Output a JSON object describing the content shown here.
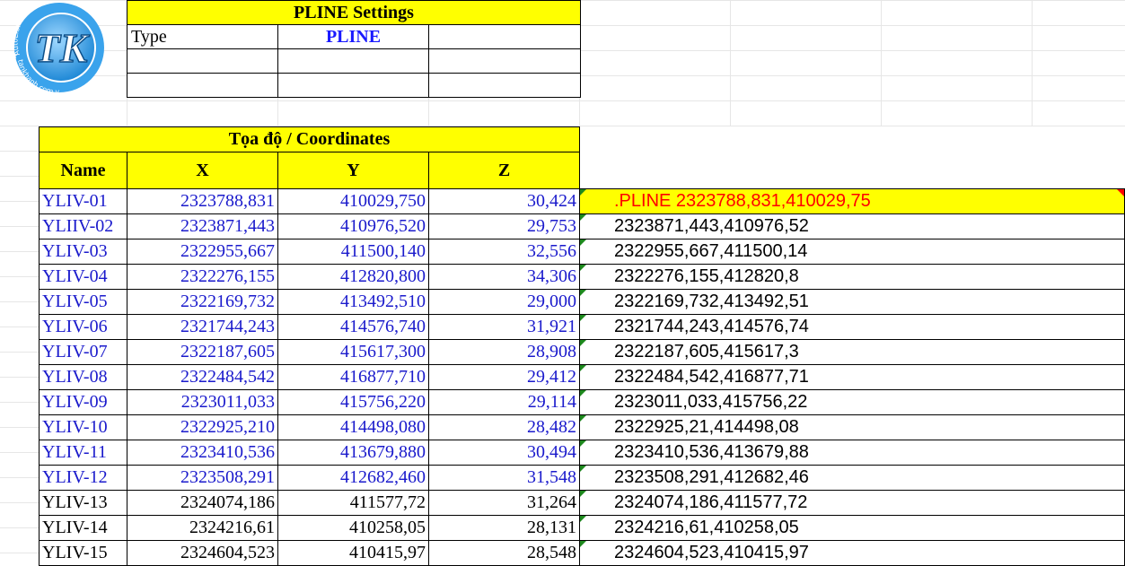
{
  "logo": {
    "initials": "TK",
    "ring_text_top": "AutoLISP Reviewer",
    "ring_text_bottom": "tankhanh.com.vn",
    "star": "★"
  },
  "settings": {
    "title": "PLINE Settings",
    "type_label": "Type",
    "type_value": "PLINE"
  },
  "coords": {
    "title": "Tọa độ / Coordinates",
    "headers": {
      "name": "Name",
      "x": "X",
      "y": "Y",
      "z": "Z"
    },
    "rows": [
      {
        "name": "YLIV-01",
        "x": "2323788,831",
        "y": "410029,750",
        "z": "30,424",
        "result": ".PLINE 2323788,831,410029,75"
      },
      {
        "name": "YLIIV-02",
        "x": "2323871,443",
        "y": "410976,520",
        "z": "29,753",
        "result": "2323871,443,410976,52"
      },
      {
        "name": "YLIV-03",
        "x": "2322955,667",
        "y": "411500,140",
        "z": "32,556",
        "result": "2322955,667,411500,14"
      },
      {
        "name": "YLIV-04",
        "x": "2322276,155",
        "y": "412820,800",
        "z": "34,306",
        "result": "2322276,155,412820,8"
      },
      {
        "name": "YLIV-05",
        "x": "2322169,732",
        "y": "413492,510",
        "z": "29,000",
        "result": "2322169,732,413492,51"
      },
      {
        "name": "YLIV-06",
        "x": "2321744,243",
        "y": "414576,740",
        "z": "31,921",
        "result": "2321744,243,414576,74"
      },
      {
        "name": "YLIV-07",
        "x": "2322187,605",
        "y": "415617,300",
        "z": "28,908",
        "result": "2322187,605,415617,3"
      },
      {
        "name": "YLIV-08",
        "x": "2322484,542",
        "y": "416877,710",
        "z": "29,412",
        "result": "2322484,542,416877,71"
      },
      {
        "name": "YLIV-09",
        "x": "2323011,033",
        "y": "415756,220",
        "z": "29,114",
        "result": "2323011,033,415756,22"
      },
      {
        "name": "YLIV-10",
        "x": "2322925,210",
        "y": "414498,080",
        "z": "28,482",
        "result": "2322925,21,414498,08"
      },
      {
        "name": "YLIV-11",
        "x": "2323410,536",
        "y": "413679,880",
        "z": "30,494",
        "result": "2323410,536,413679,88"
      },
      {
        "name": "YLIV-12",
        "x": "2323508,291",
        "y": "412682,460",
        "z": "31,548",
        "result": "2323508,291,412682,46"
      },
      {
        "name": "YLIV-13",
        "x": "2324074,186",
        "y": "411577,72",
        "z": "31,264",
        "result": "2324074,186,411577,72"
      },
      {
        "name": "YLIV-14",
        "x": "2324216,61",
        "y": "410258,05",
        "z": "28,131",
        "result": "2324216,61,410258,05"
      },
      {
        "name": "YLIV-15",
        "x": "2324604,523",
        "y": "410415,97",
        "z": "28,548",
        "result": "2324604,523,410415,97"
      }
    ]
  },
  "colors": {
    "header_fill": "#ffff00",
    "blue_text": "#1a1acc",
    "result_red": "#ff0000",
    "comment_green": "#1e8a1e"
  }
}
